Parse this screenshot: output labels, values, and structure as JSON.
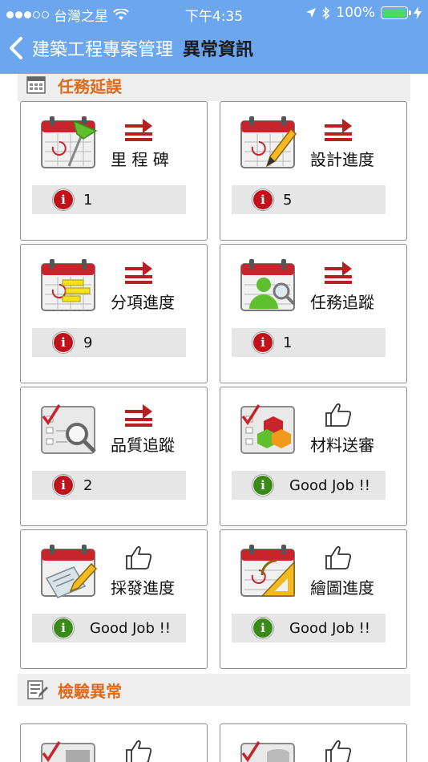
{
  "status_bar": {
    "carrier": "台灣之星",
    "time": "下午4:35",
    "battery": "100%"
  },
  "nav": {
    "app_title": "建築工程專案管理",
    "page_title": "異常資訊"
  },
  "sections": [
    {
      "title": "任務延誤",
      "cards": [
        {
          "label": "里 程 碑",
          "status": "1",
          "kind": "alert",
          "icon": "calendar-flag-icon"
        },
        {
          "label": "設計進度",
          "status": "5",
          "kind": "alert",
          "icon": "calendar-pencil-icon"
        },
        {
          "label": "分項進度",
          "status": "9",
          "kind": "alert",
          "icon": "calendar-list-icon"
        },
        {
          "label": "任務追蹤",
          "status": "1",
          "kind": "alert",
          "icon": "calendar-person-search-icon"
        },
        {
          "label": "品質追蹤",
          "status": "2",
          "kind": "alert",
          "icon": "checklist-search-icon"
        },
        {
          "label": "材料送審",
          "status": "Good Job !!",
          "kind": "good",
          "icon": "checklist-cubes-icon"
        },
        {
          "label": "採發進度",
          "status": "Good Job !!",
          "kind": "good",
          "icon": "calendar-card-pencil-icon"
        },
        {
          "label": "繪圖進度",
          "status": "Good Job !!",
          "kind": "good",
          "icon": "calendar-triangle-ruler-icon"
        }
      ]
    },
    {
      "title": "檢驗異常",
      "cards": []
    }
  ],
  "colors": {
    "header_bg": "#6ba6ef",
    "section_title": "#e06a1b",
    "alert": "#c0121a",
    "good": "#3a8a18",
    "arrow": "#b52121"
  }
}
